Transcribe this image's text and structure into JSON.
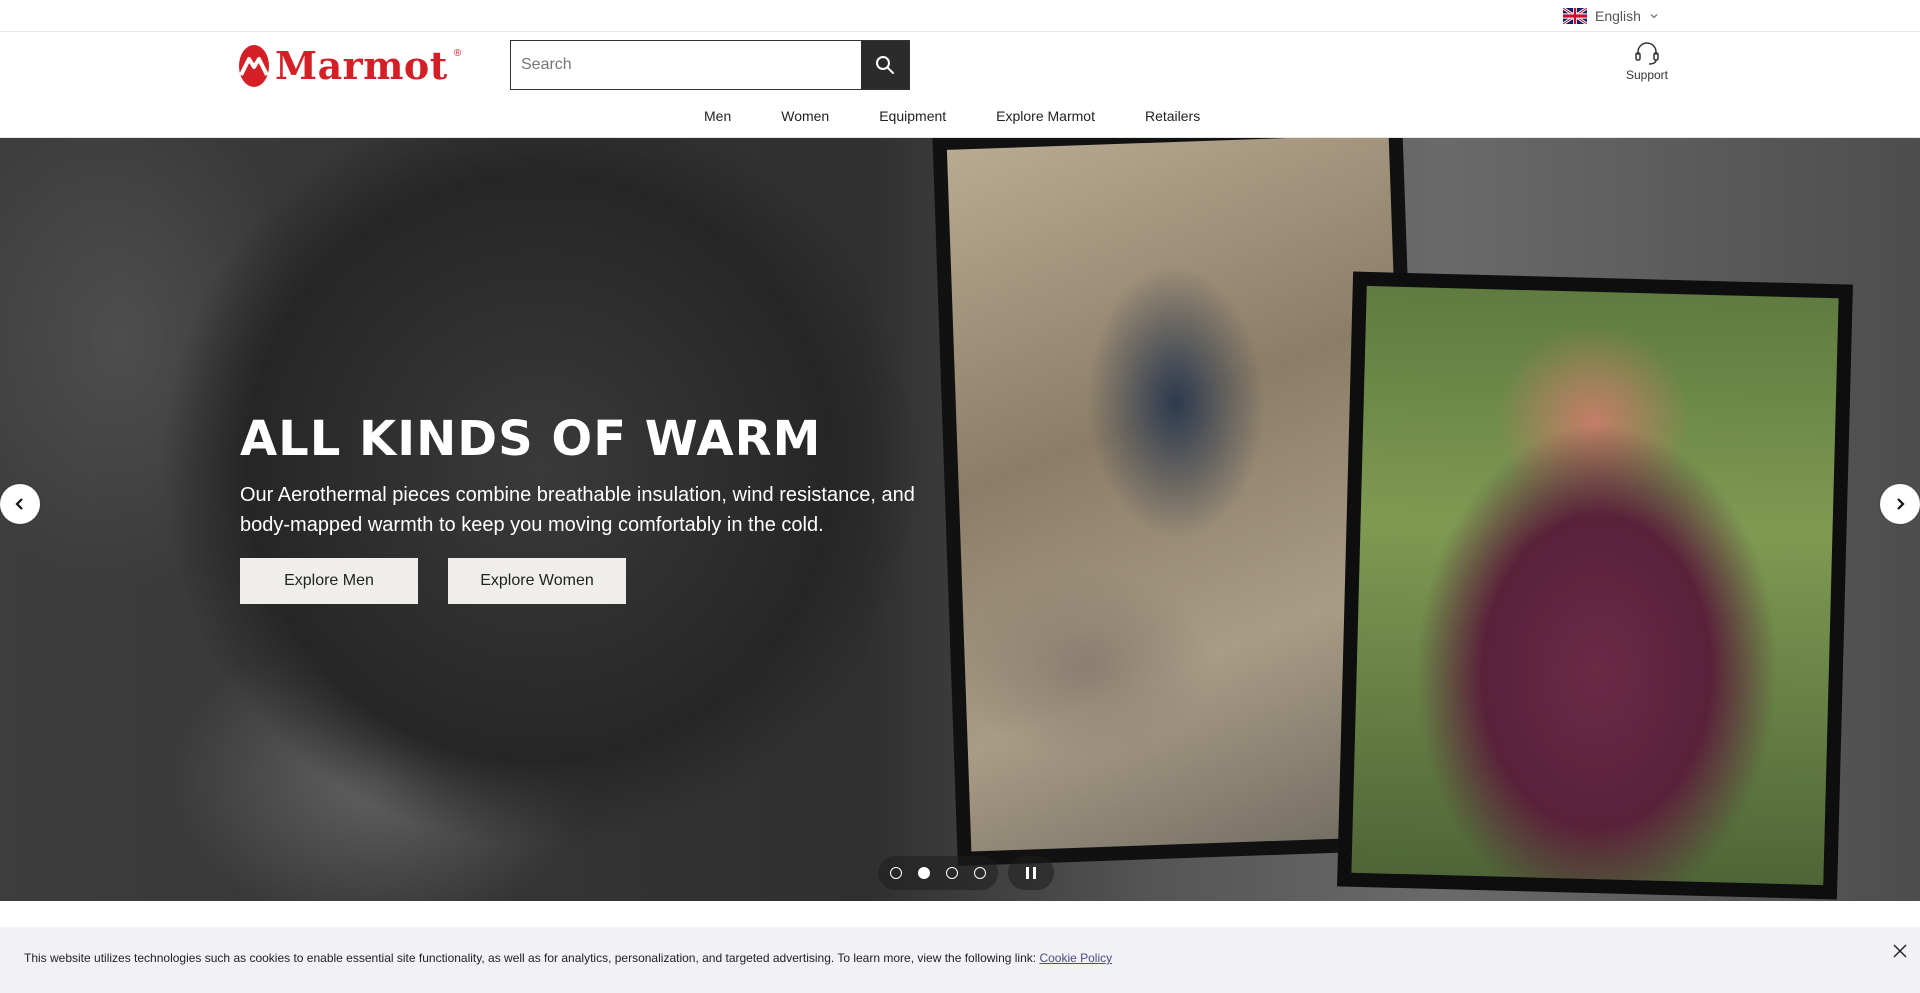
{
  "utility_bar": {
    "language": "English"
  },
  "header": {
    "brand": "Marmot",
    "search": {
      "placeholder": "Search",
      "value": ""
    },
    "support_label": "Support"
  },
  "nav": {
    "items": [
      {
        "label": "Men"
      },
      {
        "label": "Women"
      },
      {
        "label": "Equipment"
      },
      {
        "label": "Explore Marmot"
      },
      {
        "label": "Retailers"
      }
    ]
  },
  "hero": {
    "title": "ALL KINDS OF WARM",
    "text": "Our Aerothermal pieces combine breathable insulation, wind resistance, and body-mapped warmth to keep you moving comfortably in the cold.",
    "buttons": [
      {
        "label": "Explore Men"
      },
      {
        "label": "Explore Women"
      }
    ],
    "slides_count": 4,
    "active_slide": 2
  },
  "cookie": {
    "text": "This website utilizes technologies such as cookies to enable essential site functionality, as well as for analytics, personalization, and targeted advertising. To learn more, view the following link: ",
    "link_label": "Cookie Policy"
  },
  "colors": {
    "brand_red": "#d41f26",
    "search_button": "#2b2b2b",
    "hero_button_bg": "#efeeea",
    "cookie_bg": "#f1f1f6"
  },
  "icons": [
    "uk-flag-icon",
    "chevron-down-icon",
    "search-icon",
    "headset-icon",
    "chevron-left-icon",
    "chevron-right-icon",
    "pause-icon",
    "close-icon"
  ]
}
